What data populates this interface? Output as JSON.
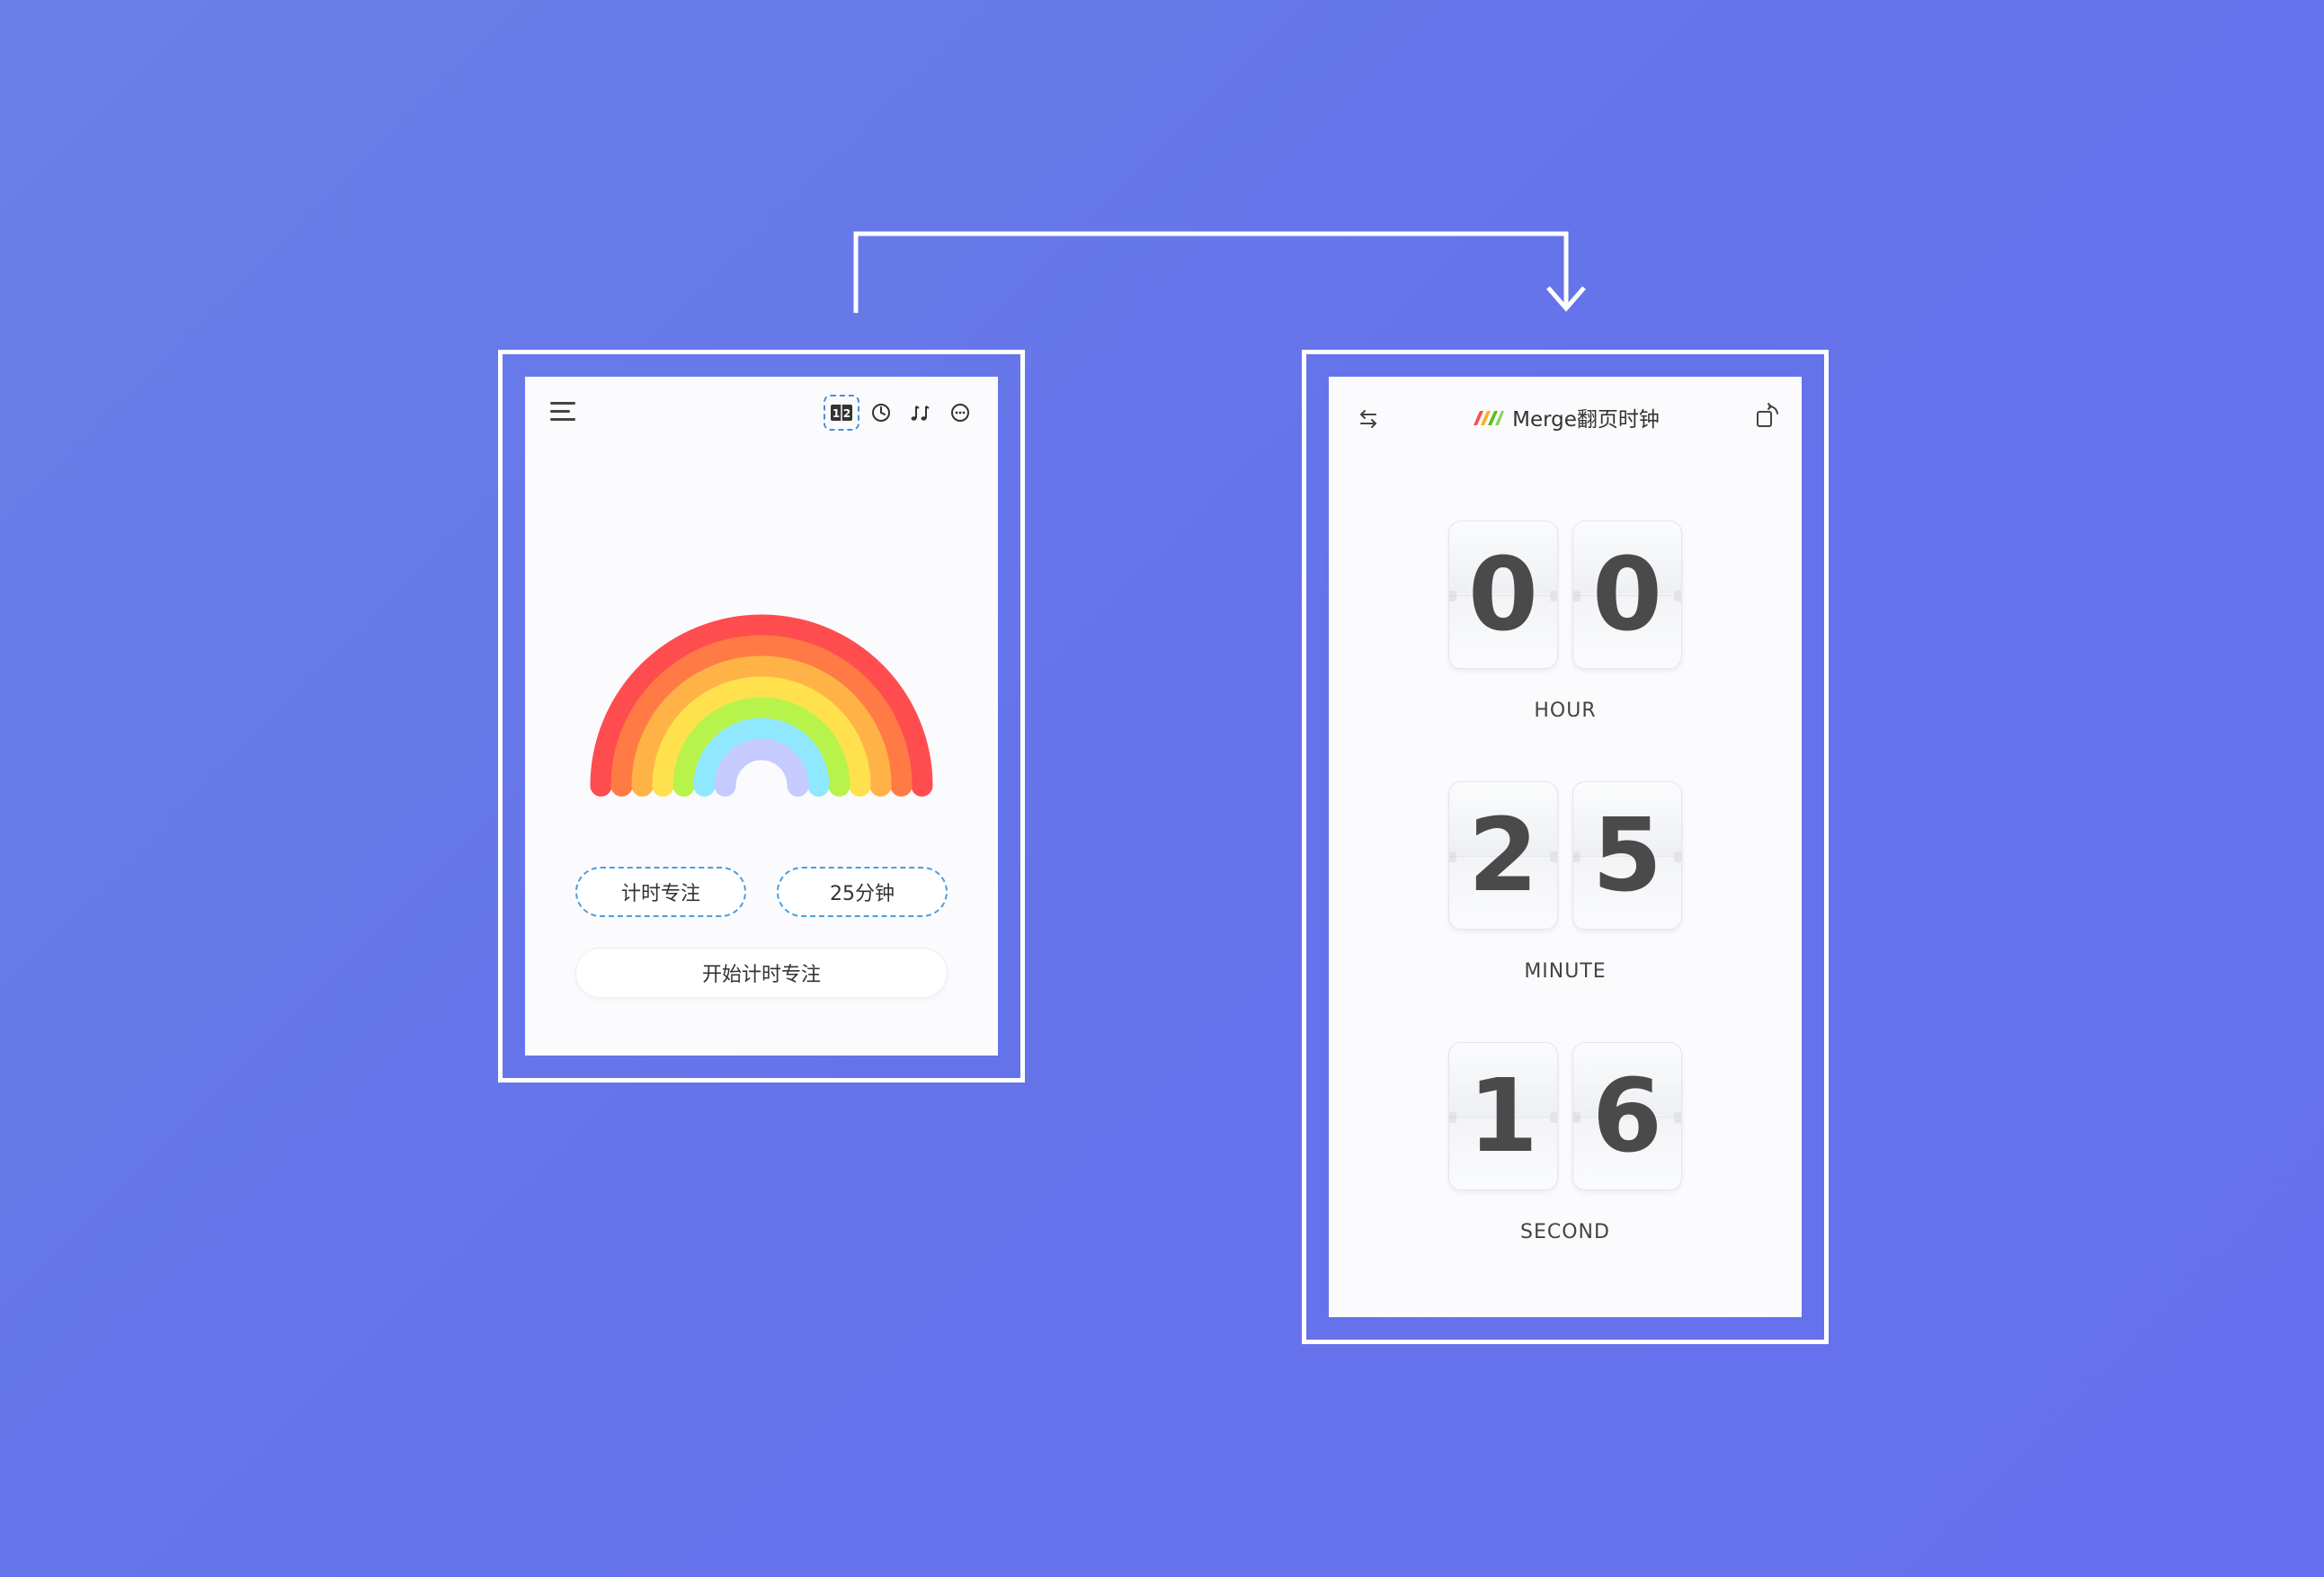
{
  "left_screen": {
    "toolbar": {
      "items": [
        {
          "name": "flip-clock-icon",
          "glyph": "1|2",
          "selected": true
        },
        {
          "name": "clock-icon"
        },
        {
          "name": "music-icon"
        },
        {
          "name": "more-icon"
        }
      ]
    },
    "mode_label": "计时专注",
    "duration_label": "25分钟",
    "start_label": "开始计时专注",
    "rainbow_colors": [
      "#ff4d4f",
      "#ff7a45",
      "#ffb347",
      "#ffe14d",
      "#b7f34a",
      "#8fe8ff",
      "#c5cbff"
    ]
  },
  "right_screen": {
    "brand_name": "Merge翻页时钟",
    "brand_colors": [
      "#ff4d4f",
      "#ffb020",
      "#52c41a"
    ],
    "hour": {
      "d1": "0",
      "d2": "0",
      "label": "HOUR"
    },
    "minute": {
      "d1": "2",
      "d2": "5",
      "label": "MINUTE"
    },
    "second": {
      "d1": "1",
      "d2": "6",
      "label": "SECOND"
    }
  }
}
